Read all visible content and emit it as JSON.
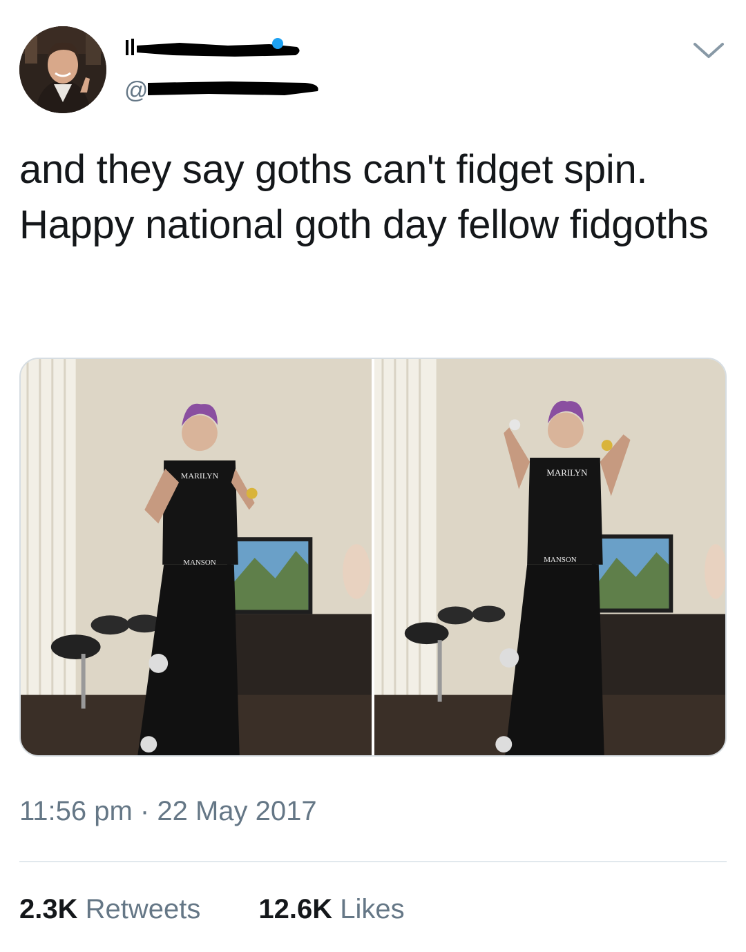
{
  "tweet": {
    "handle_prefix": "@",
    "text": "and they say goths can't fidget spin.\nHappy national goth day fellow fidgoths",
    "time": "11:56 pm",
    "separator": " · ",
    "date": "22 May 2017",
    "stats": {
      "retweets_count": "2.3K",
      "retweets_label": "Retweets",
      "likes_count": "12.6K",
      "likes_label": "Likes"
    }
  },
  "icons": {
    "menu": "chevron-down-icon",
    "verified": "verified-badge-icon"
  },
  "photos": [
    {
      "shirt_top": "MARILYN",
      "shirt_bottom": "MANSON"
    },
    {
      "shirt_top": "MARILYN",
      "shirt_bottom": "MANSON"
    }
  ],
  "colors": {
    "text": "#14171a",
    "secondary": "#657786",
    "divider": "#e1e8ed",
    "verified": "#1da1f2"
  }
}
